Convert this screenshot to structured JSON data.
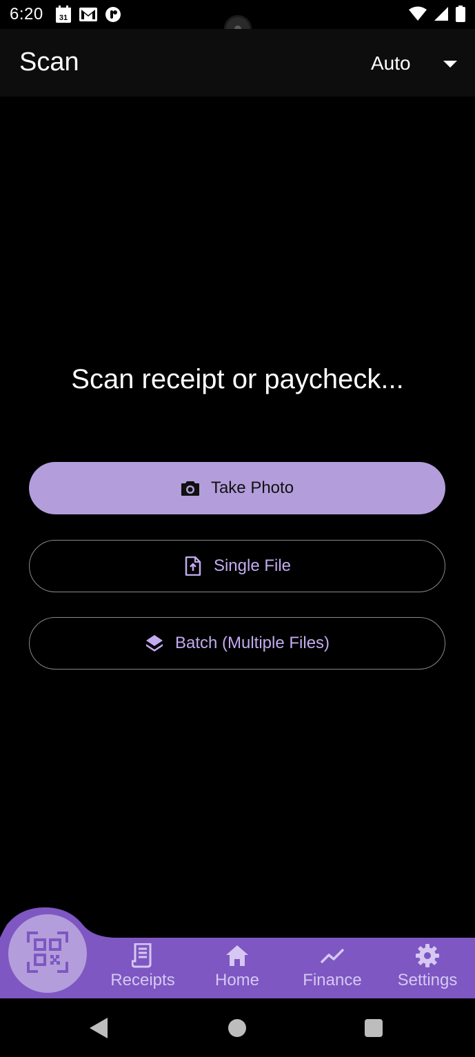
{
  "status_bar": {
    "time": "6:20",
    "calendar_day": "31",
    "left_icons": [
      "calendar-icon",
      "gmail-icon",
      "app-notification-icon"
    ],
    "right_icons": [
      "wifi-icon",
      "signal-icon",
      "battery-icon"
    ]
  },
  "app_bar": {
    "title": "Scan",
    "mode_value": "Auto"
  },
  "main": {
    "prompt": "Scan receipt or paycheck...",
    "take_photo_label": "Take Photo",
    "single_file_label": "Single File",
    "batch_label": "Batch (Multiple Files)"
  },
  "bottom_nav": {
    "active": "scan",
    "items": [
      {
        "id": "receipts",
        "label": "Receipts",
        "icon": "receipt-icon"
      },
      {
        "id": "home",
        "label": "Home",
        "icon": "home-icon"
      },
      {
        "id": "finance",
        "label": "Finance",
        "icon": "trending-icon"
      },
      {
        "id": "settings",
        "label": "Settings",
        "icon": "gear-icon"
      }
    ]
  },
  "colors": {
    "accent": "#b39ddb",
    "nav_background": "#7e57c2",
    "outline_text": "#c3abf0",
    "background": "#000000"
  }
}
